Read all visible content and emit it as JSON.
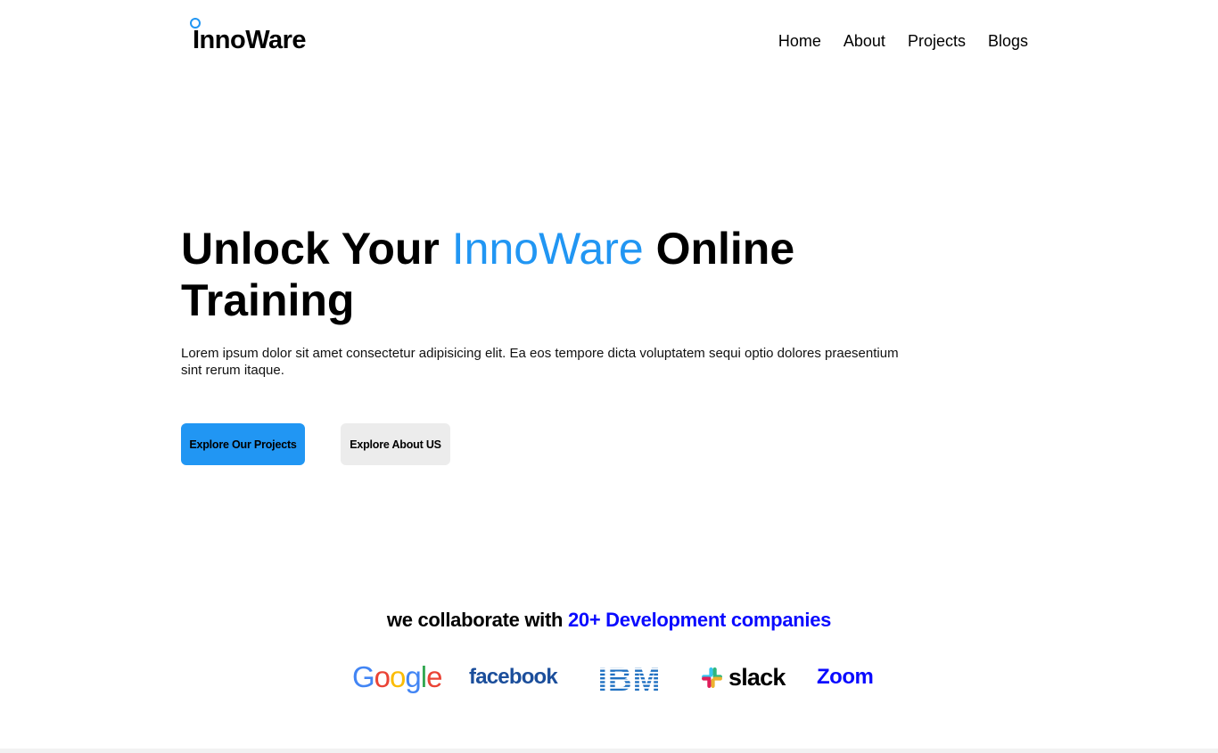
{
  "brand": {
    "name": "InnoWare",
    "accent_color": "#2196f3"
  },
  "nav": {
    "items": [
      "Home",
      "About",
      "Projects",
      "Blogs"
    ]
  },
  "hero": {
    "title_prefix": "Unlock Your ",
    "title_accent": "InnoWare",
    "title_suffix": " Online Training",
    "description": "Lorem ipsum dolor sit amet consectetur adipisicing elit. Ea eos tempore dicta voluptatem sequi optio dolores praesentium sint rerum itaque.",
    "primary_button": "Explore Our Projects",
    "secondary_button": "Explore About US"
  },
  "collab": {
    "prefix": "we collaborate with ",
    "accent": "20+ Development companies",
    "accent_color": "#0a0aff"
  },
  "partners": {
    "google": "Google",
    "facebook": "facebook",
    "ibm": "IBM",
    "slack": "slack",
    "zoom": "Zoom"
  }
}
